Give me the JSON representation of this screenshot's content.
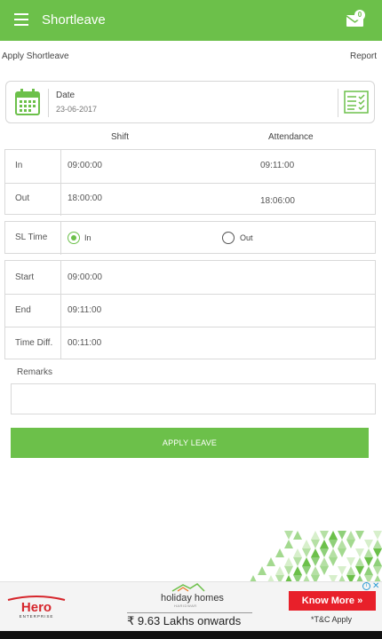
{
  "appbar": {
    "title": "Shortleave",
    "inbox_count": "0",
    "menu_icon": "menu-icon",
    "inbox_icon": "inbox-icon"
  },
  "nav": {
    "apply": "Apply Shortleave",
    "report": "Report"
  },
  "date": {
    "label": "Date",
    "value": "23-06-2017",
    "calendar_icon": "calendar-icon",
    "list_icon": "checklist-icon"
  },
  "columns": {
    "shift": "Shift",
    "attendance": "Attendance"
  },
  "times": {
    "in": {
      "label": "In",
      "shift": "09:00:00",
      "attendance": "09:11:00"
    },
    "out": {
      "label": "Out",
      "shift": "18:00:00",
      "attendance": "18:06:00"
    }
  },
  "sl_time": {
    "label": "SL Time",
    "options": [
      "In",
      "Out"
    ],
    "selected": "In"
  },
  "range": {
    "start": {
      "label": "Start",
      "value": "09:00:00"
    },
    "end": {
      "label": "End",
      "value": "09:11:00"
    },
    "diff": {
      "label": "Time Diff.",
      "value": "00:11:00"
    }
  },
  "remarks": {
    "label": "Remarks",
    "value": ""
  },
  "apply_button": "APPLY LEAVE",
  "ad": {
    "logo_text": "Hero",
    "logo_sub": "ENTERPRISE",
    "brand": "holiday homes",
    "brand_sub": "HARIDWAR",
    "price": "₹ 9.63 Lakhs onwards",
    "cta": "Know More",
    "terms": "*T&C Apply"
  },
  "colors": {
    "primary": "#6cc04a",
    "ad_cta": "#e8202a",
    "ad_logo": "#d6262c"
  }
}
